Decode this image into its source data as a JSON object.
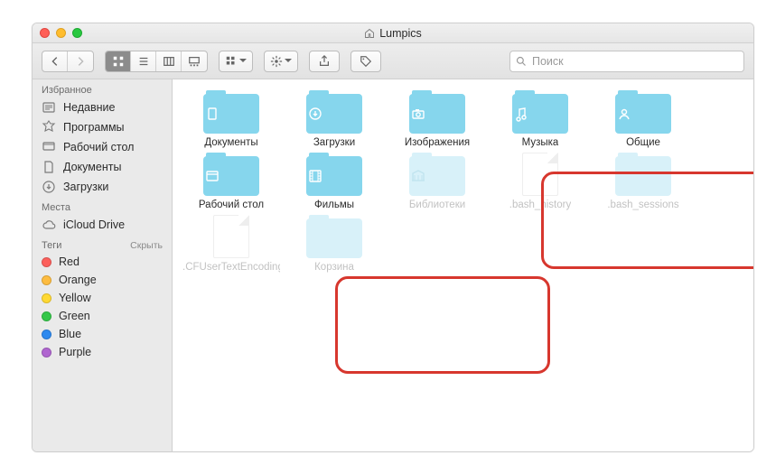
{
  "window": {
    "title": "Lumpics"
  },
  "toolbar": {
    "search_placeholder": "Поиск"
  },
  "sidebar": {
    "sections": {
      "favorites": {
        "label": "Избранное",
        "items": [
          {
            "label": "Недавние"
          },
          {
            "label": "Программы"
          },
          {
            "label": "Рабочий стол"
          },
          {
            "label": "Документы"
          },
          {
            "label": "Загрузки"
          }
        ]
      },
      "places": {
        "label": "Места",
        "items": [
          {
            "label": "iCloud Drive"
          }
        ]
      },
      "tags": {
        "label": "Теги",
        "hide_label": "Скрыть",
        "items": [
          {
            "label": "Red",
            "color": "#fc605c"
          },
          {
            "label": "Orange",
            "color": "#fdbc40"
          },
          {
            "label": "Yellow",
            "color": "#ffd933"
          },
          {
            "label": "Green",
            "color": "#34c749"
          },
          {
            "label": "Blue",
            "color": "#2d89ef"
          },
          {
            "label": "Purple",
            "color": "#b066d0"
          }
        ]
      }
    }
  },
  "items": [
    {
      "label": "Документы",
      "kind": "folder",
      "faded": false,
      "glyph": "doc"
    },
    {
      "label": "Загрузки",
      "kind": "folder",
      "faded": false,
      "glyph": "down"
    },
    {
      "label": "Изображения",
      "kind": "folder",
      "faded": false,
      "glyph": "camera"
    },
    {
      "label": "Музыка",
      "kind": "folder",
      "faded": false,
      "glyph": "music"
    },
    {
      "label": "Общие",
      "kind": "folder",
      "faded": false,
      "glyph": "person"
    },
    {
      "label": "Рабочий стол",
      "kind": "folder",
      "faded": false,
      "glyph": "window"
    },
    {
      "label": "Фильмы",
      "kind": "folder",
      "faded": false,
      "glyph": "film"
    },
    {
      "label": "Библиотеки",
      "kind": "folder",
      "faded": true,
      "glyph": "library"
    },
    {
      "label": ".bash_history",
      "kind": "file",
      "faded": true
    },
    {
      "label": ".bash_sessions",
      "kind": "folder",
      "faded": true,
      "glyph": ""
    },
    {
      "label": ".CFUserTextEncoding",
      "kind": "file",
      "faded": true
    },
    {
      "label": "Корзина",
      "kind": "folder",
      "faded": true,
      "glyph": ""
    }
  ]
}
